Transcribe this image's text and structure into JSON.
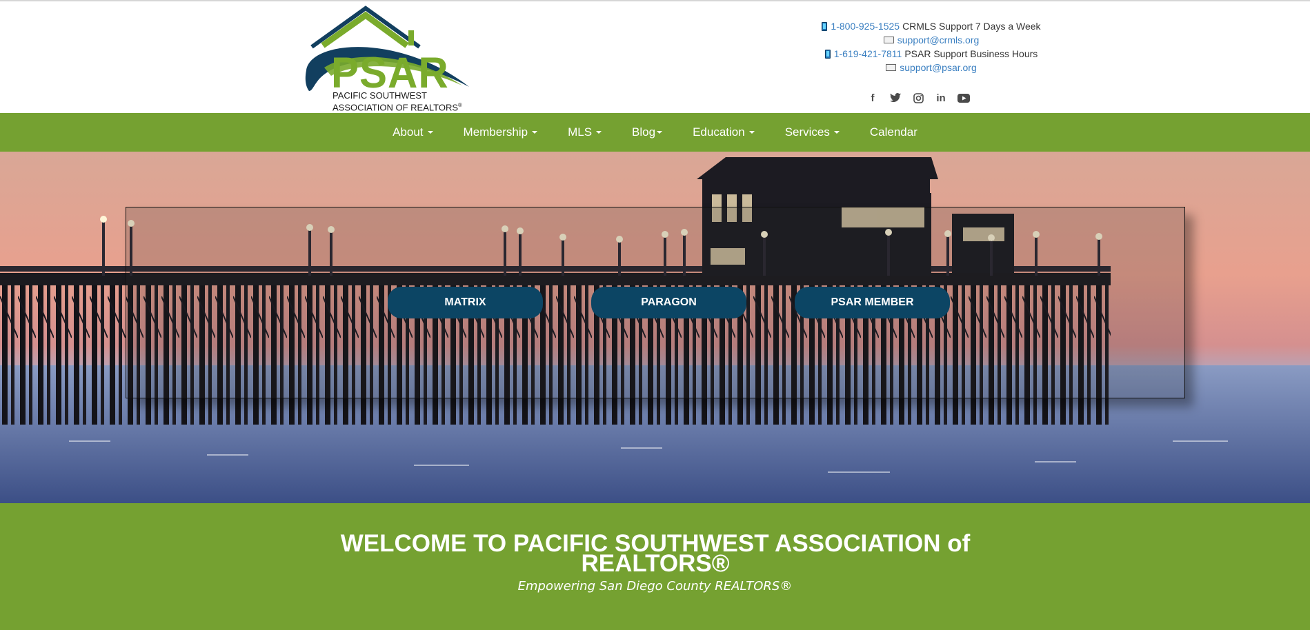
{
  "header": {
    "logo": {
      "word": "PSAR",
      "line1": "PACIFIC SOUTHWEST",
      "line2": "ASSOCIATION OF REALTORS",
      "line2_mark": "®",
      "colors": {
        "green": "#7aab2c",
        "navy": "#123f5f"
      }
    },
    "contacts": [
      {
        "icon": "phone-icon",
        "link": "1-800-925-1525",
        "text": "CRMLS Support 7 Days a Week"
      },
      {
        "icon": "mail-icon",
        "link": "support@crmls.org"
      },
      {
        "icon": "phone-icon",
        "link": "1-619-421-7811",
        "text": " PSAR Support Business Hours"
      },
      {
        "icon": "mail-icon",
        "link": "support@psar.org"
      }
    ],
    "social": [
      {
        "name": "facebook-icon",
        "glyph": "f"
      },
      {
        "name": "twitter-icon",
        "glyph": "🐦"
      },
      {
        "name": "instagram-icon",
        "glyph": "◎"
      },
      {
        "name": "linkedin-icon",
        "glyph": "in"
      },
      {
        "name": "youtube-icon",
        "glyph": "▶"
      }
    ]
  },
  "nav": {
    "items": [
      {
        "label": "About"
      },
      {
        "label": "Membership"
      },
      {
        "label": "MLS"
      },
      {
        "label": "Blog"
      },
      {
        "label": "Education"
      },
      {
        "label": "Services"
      },
      {
        "label": "Calendar"
      }
    ],
    "background": "#75a131"
  },
  "hero": {
    "buttons": [
      {
        "label": "MATRIX"
      },
      {
        "label": "PARAGON"
      },
      {
        "label": "PSAR MEMBER"
      }
    ],
    "button_color": "#0c4564"
  },
  "welcome": {
    "title": "WELCOME TO PACIFIC SOUTHWEST ASSOCIATION of REALTORS®",
    "subtitle": "Empowering San Diego County REALTORS®"
  }
}
